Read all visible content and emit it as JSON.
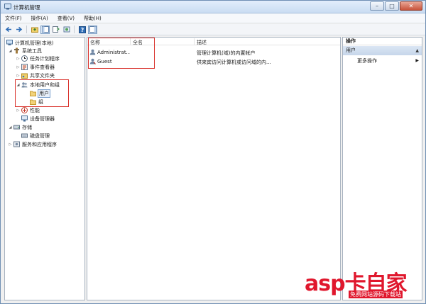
{
  "window": {
    "title": "计算机管理",
    "minimize": "–",
    "maximize": "□",
    "close": "✕"
  },
  "menu": [
    "文件(F)",
    "操作(A)",
    "查看(V)",
    "帮助(H)"
  ],
  "tree": {
    "root": "计算机管理(本地)",
    "system_tools": "系统工具",
    "task_scheduler": "任务计划程序",
    "event_viewer": "事件查看器",
    "shared_folders": "共享文件夹",
    "local_users_groups": "本地用户和组",
    "users": "用户",
    "groups": "组",
    "performance": "性能",
    "device_manager": "设备管理器",
    "storage": "存储",
    "disk_management": "磁盘管理",
    "services_apps": "服务和应用程序"
  },
  "list": {
    "columns": [
      "名称",
      "全名",
      "描述"
    ],
    "rows": [
      {
        "name": "Administrat...",
        "fullname": "",
        "desc": "管理计算机(域)的内置帐户"
      },
      {
        "name": "Guest",
        "fullname": "",
        "desc": "供来宾访问计算机或访问域的内..."
      }
    ]
  },
  "actions": {
    "header": "操作",
    "section": "用户",
    "collapse": "▲",
    "more": "更多操作",
    "more_arrow": "▶"
  },
  "watermark": {
    "main": "asp卡自家",
    "sub": "免费网站源码下载站"
  },
  "colors": {
    "highlight": "#d9322c",
    "watermark": "#e0172d",
    "selection": "#e8f0fa"
  }
}
